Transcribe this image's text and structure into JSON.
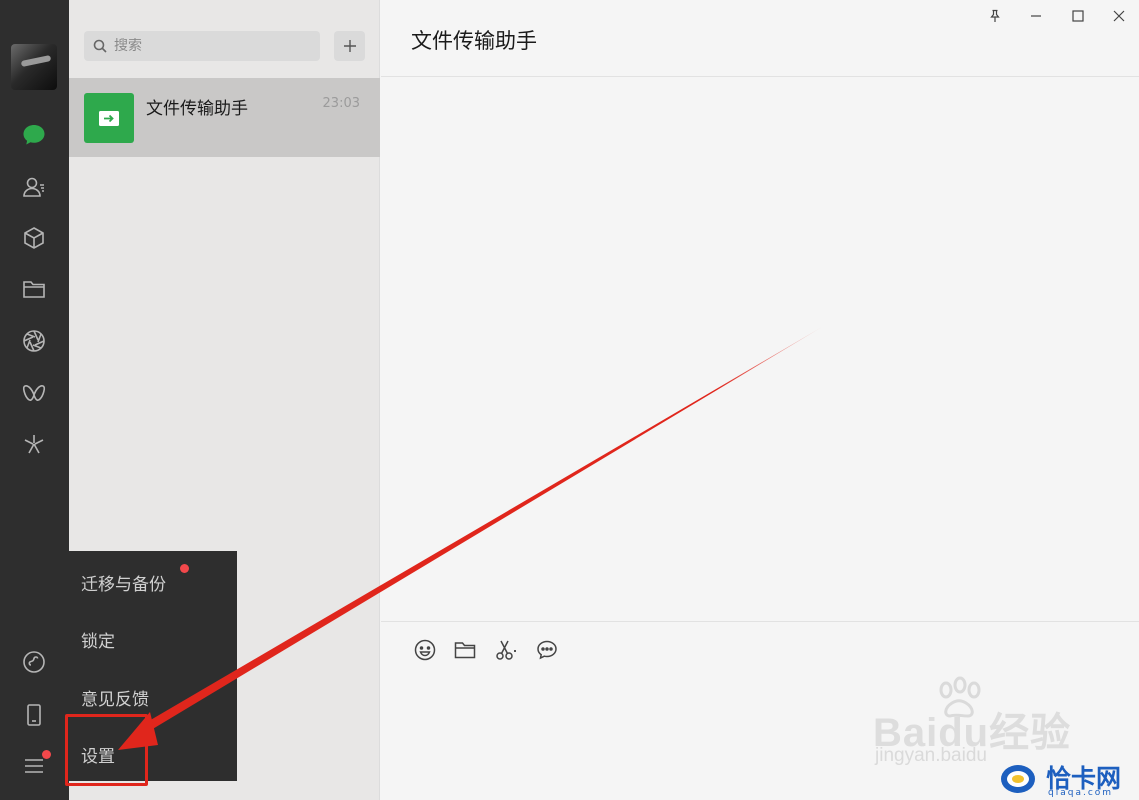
{
  "sidebar": {
    "items": [
      "chat",
      "contacts",
      "favorites",
      "files",
      "moments",
      "channels",
      "top-stories",
      "mini-programs",
      "phone",
      "menu"
    ]
  },
  "search": {
    "placeholder": "搜索"
  },
  "chats": [
    {
      "name": "文件传输助手",
      "time": "23:03"
    }
  ],
  "menu": {
    "items": [
      "迁移与备份",
      "锁定",
      "意见反馈",
      "设置"
    ]
  },
  "main": {
    "title": "文件传输助手"
  },
  "watermark": {
    "baidu": "Baidu经验",
    "jingyan": "jingyan.baidu",
    "site": "恰卡网",
    "site_url": "qiaqa.com"
  },
  "colors": {
    "accent": "#2ea94c",
    "badge": "#f2484b",
    "annotation": "#e0261c",
    "rail": "#2e2e2e"
  }
}
